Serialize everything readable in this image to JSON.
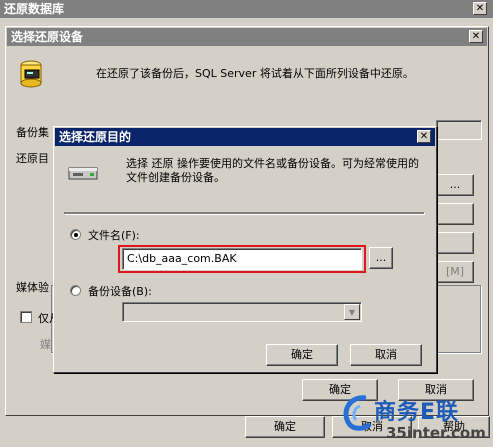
{
  "outer": {
    "title": "还原数据库",
    "ok": "确定",
    "cancel": "取消",
    "help": "帮助"
  },
  "device_dialog": {
    "title": "选择还原设备",
    "message": "在还原了该备份后，SQL Server 将试着从下面所列设备中还原。",
    "backup_set_label": "备份集",
    "restore_label": "还原目",
    "media_label": "媒体验",
    "only_label": "仅从",
    "media_sub": "媒",
    "ok": "确定",
    "cancel": "取消"
  },
  "dest_dialog": {
    "title": "选择还原目的",
    "description": "选择 还原 操作要使用的文件名或备份设备。可为经常使用的文件创建备份设备。",
    "filename_label": "文件名(F):",
    "filename_value": "C:\\db_aaa_com.BAK",
    "browse": "...",
    "device_label": "备份设备(B):",
    "device_value": "",
    "ok": "确定",
    "cancel": "取消"
  },
  "side_buttons": [
    "...",
    "",
    "",
    "[M]"
  ],
  "watermark": {
    "brand": "商务E联",
    "url": "35inter.com"
  },
  "colors": {
    "highlight_border": "#e0141a",
    "title_active": "#0a246a"
  }
}
